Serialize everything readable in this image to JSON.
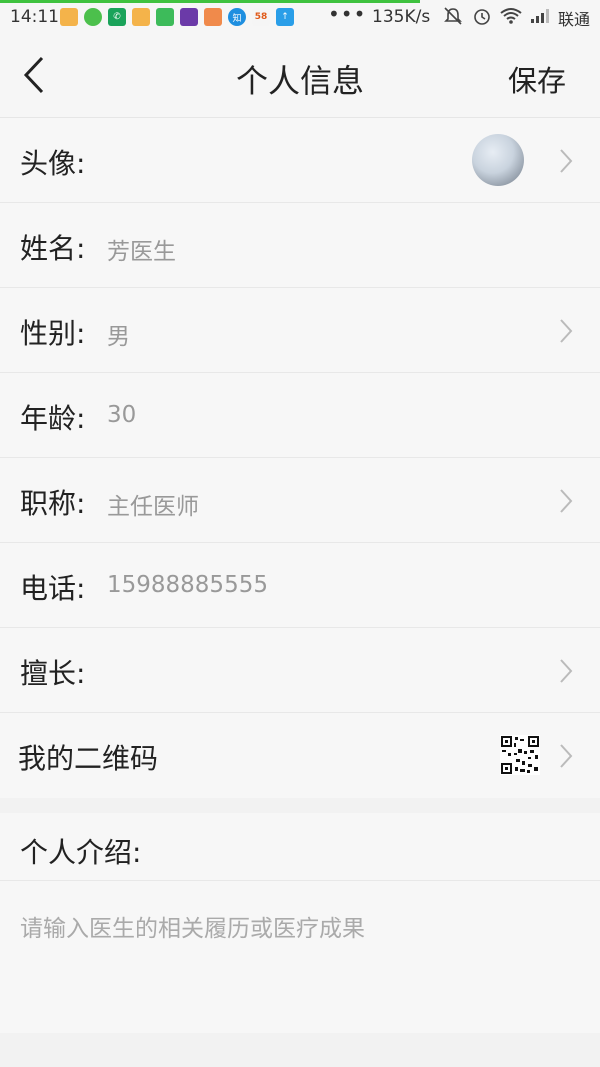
{
  "status_bar": {
    "time": "14:11",
    "network_speed": "135K/s",
    "carrier": "联通",
    "icons": [
      "notification-icon",
      "wechat-icon",
      "phone-icon",
      "notification-icon",
      "app-icon",
      "app-icon",
      "app-icon",
      "zhi-icon",
      "58-icon",
      "upload-icon"
    ],
    "app_icon_labels": {
      "zhi": "知",
      "fifty_eight": "58"
    }
  },
  "header": {
    "title": "个人信息",
    "save_label": "保存"
  },
  "rows": [
    {
      "label": "头像:",
      "value": "",
      "has_chevron": true
    },
    {
      "label": "姓名:",
      "value": "芳医生",
      "has_chevron": false
    },
    {
      "label": "性别:",
      "value": "男",
      "has_chevron": true
    },
    {
      "label": "年龄:",
      "value": "30",
      "has_chevron": false
    },
    {
      "label": "职称:",
      "value": "主任医师",
      "has_chevron": true
    },
    {
      "label": "电话:",
      "value": "15988885555",
      "has_chevron": false
    },
    {
      "label": "擅长:",
      "value": "",
      "has_chevron": true
    },
    {
      "label": "我的二维码",
      "value": "",
      "has_chevron": true
    }
  ],
  "intro": {
    "title": "个人介绍:",
    "placeholder": "请输入医生的相关履历或医疗成果"
  },
  "colors": {
    "background": "#f2f2f2",
    "row_background": "#f7f7f7",
    "value_text": "#999999",
    "progress": "#3fc23f"
  }
}
